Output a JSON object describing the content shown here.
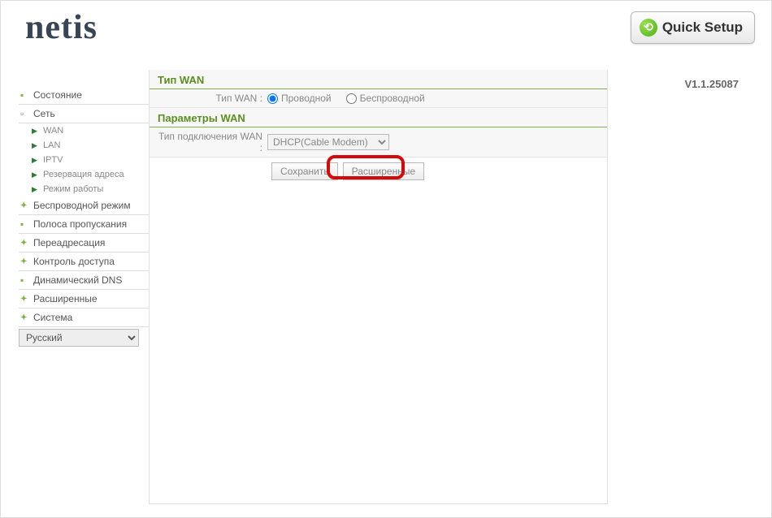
{
  "header": {
    "logo": "netis",
    "quick_setup_label": "Quick Setup",
    "version": "V1.1.25087"
  },
  "sidebar": {
    "items": [
      {
        "label": "Состояние",
        "expanded": false
      },
      {
        "label": "Сеть",
        "expanded": true,
        "children": [
          {
            "label": "WAN"
          },
          {
            "label": "LAN"
          },
          {
            "label": "IPTV"
          },
          {
            "label": "Резервация адреса"
          },
          {
            "label": "Режим работы"
          }
        ]
      },
      {
        "label": "Беспроводной режим",
        "expanded": false,
        "cross": true
      },
      {
        "label": "Полоса пропускания",
        "expanded": false
      },
      {
        "label": "Переадресация",
        "expanded": false,
        "cross": true
      },
      {
        "label": "Контроль доступа",
        "expanded": false,
        "cross": true
      },
      {
        "label": "Динамический DNS",
        "expanded": false
      },
      {
        "label": "Расширенные",
        "expanded": false,
        "cross": true
      },
      {
        "label": "Система",
        "expanded": false,
        "cross": true
      }
    ],
    "language": "Русский"
  },
  "main": {
    "section_wan_type_title": "Тип WAN",
    "wan_type_label": "Тип WAN :",
    "wan_type_options": {
      "wired": "Проводной",
      "wireless": "Беспроводной"
    },
    "section_wan_params_title": "Параметры WAN",
    "conn_type_label": "Тип подключения WAN :",
    "conn_type_value": "DHCP(Cable Modem)",
    "buttons": {
      "save": "Сохранить",
      "advanced": "Расширенные"
    }
  }
}
